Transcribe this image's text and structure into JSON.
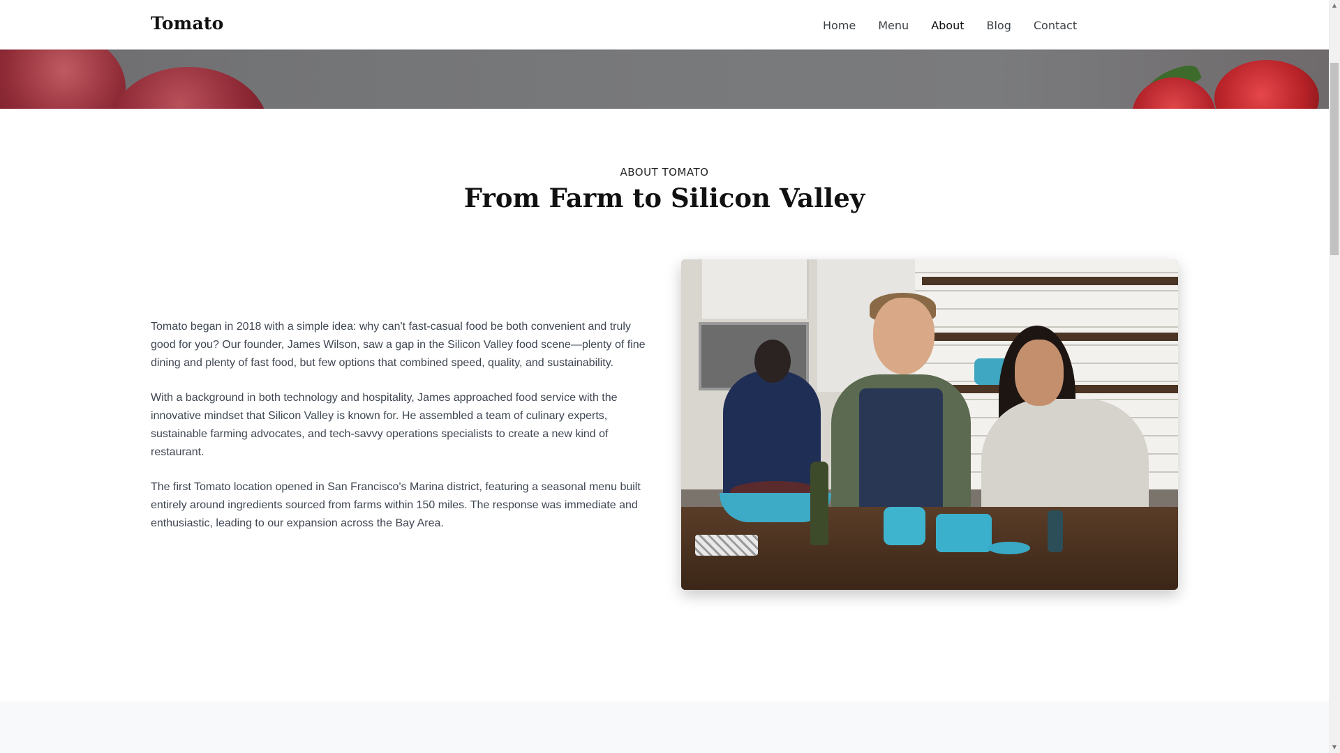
{
  "header": {
    "brand": "Tomato",
    "nav": [
      "Home",
      "Menu",
      "About",
      "Blog",
      "Contact"
    ],
    "active_nav": "About"
  },
  "about": {
    "eyebrow": "ABOUT TOMATO",
    "title": "From Farm to Silicon Valley",
    "paragraphs": [
      "Tomato began in 2018 with a simple idea: why can't fast-casual food be both convenient and truly good for you? Our founder, James Wilson, saw a gap in the Silicon Valley food scene—plenty of fine dining and plenty of fast food, but few options that combined speed, quality, and sustainability.",
      "With a background in both technology and hospitality, James approached food service with the innovative mindset that Silicon Valley is known for. He assembled a team of culinary experts, sustainable farming advocates, and tech-savvy operations specialists to create a new kind of restaurant.",
      "The first Tomato location opened in San Francisco's Marina district, featuring a seasonal menu built entirely around ingredients sourced from farms within 150 miles. The response was immediate and enthusiastic, leading to our expansion across the Bay Area."
    ],
    "image_subject": "people-cooking-in-kitchen"
  },
  "icons": {
    "scroll_up": "scroll-up-arrow",
    "scroll_down": "scroll-down-arrow"
  },
  "colors": {
    "hero_overlay": "#78797b",
    "band": "#f8f9fa",
    "text": "#3f4652",
    "heading": "#111111"
  }
}
